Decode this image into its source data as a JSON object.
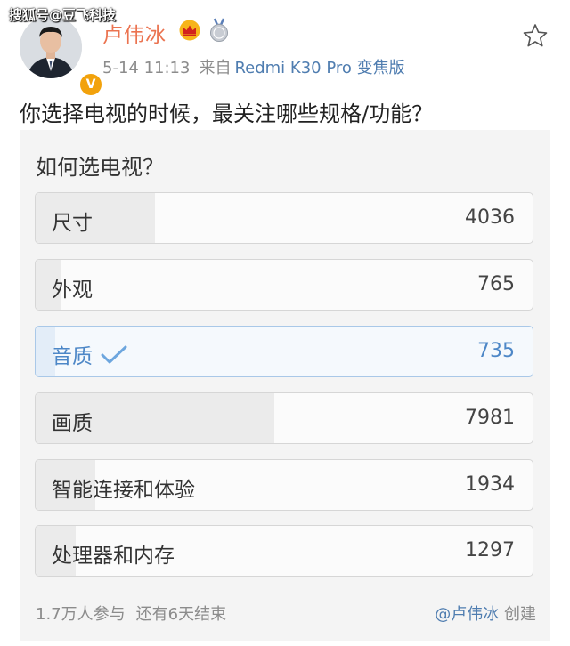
{
  "watermark": "搜狐号@豆飞科技",
  "author": {
    "name": "卢伟冰",
    "verified_badge": "V",
    "badges": [
      "crown-icon",
      "medal-icon"
    ]
  },
  "meta": {
    "time": "5-14 11:13",
    "source_prefix": "来自",
    "device": "Redmi K30 Pro 变焦版"
  },
  "post_text": "你选择电视的时候，最关注哪些规格/功能？",
  "poll": {
    "title": "如何选电视？",
    "options": [
      {
        "label": "尺寸",
        "count": "4036",
        "fill": 0.24,
        "selected": false
      },
      {
        "label": "外观",
        "count": "765",
        "fill": 0.05,
        "selected": false
      },
      {
        "label": "音质",
        "count": "735",
        "fill": 0.04,
        "selected": true
      },
      {
        "label": "画质",
        "count": "7981",
        "fill": 0.48,
        "selected": false
      },
      {
        "label": "智能连接和体验",
        "count": "1934",
        "fill": 0.12,
        "selected": false
      },
      {
        "label": "处理器和内存",
        "count": "1297",
        "fill": 0.08,
        "selected": false
      }
    ],
    "participants": "1.7万人参与",
    "remaining": "还有6天结束",
    "creator_name": "@卢伟冰",
    "creator_suffix": "创建"
  },
  "colors": {
    "accent_orange": "#eb7350",
    "link_blue": "#4f7db0",
    "selected_blue": "#4d87c7"
  }
}
